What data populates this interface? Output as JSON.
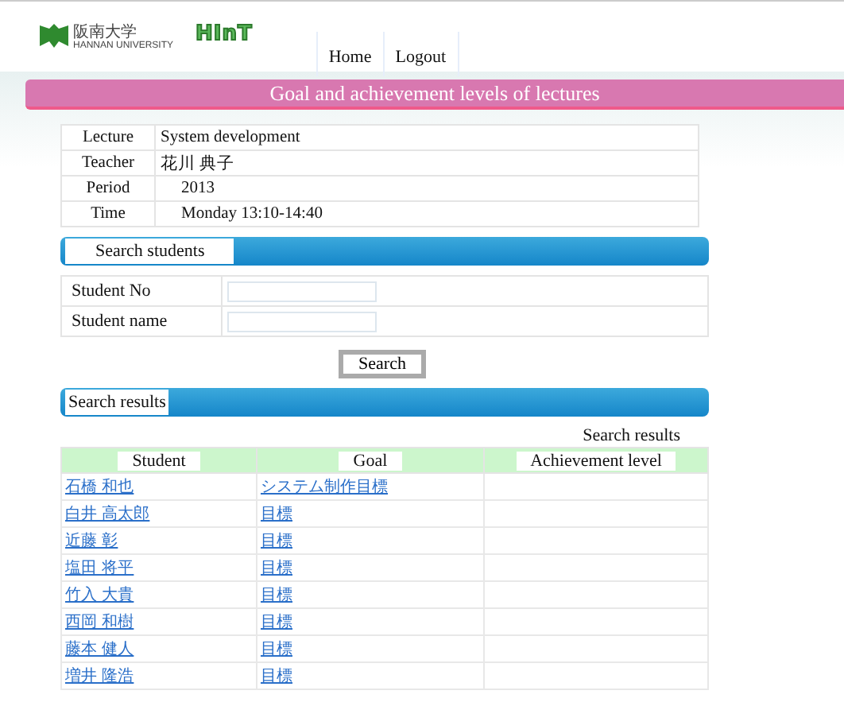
{
  "header": {
    "university_name": "阪南大学",
    "university_subtitle": "HANNAN UNIVERSITY",
    "app_logo": "HInT",
    "nav": [
      "Home",
      "Logout"
    ]
  },
  "page_title": "Goal and achievement levels of lectures",
  "lecture_info": [
    {
      "label": "Lecture",
      "value": "System development"
    },
    {
      "label": "Teacher",
      "value": "花川 典子"
    },
    {
      "label": "Period",
      "value": "2013"
    },
    {
      "label": "Time",
      "value": "Monday 13:10-14:40"
    }
  ],
  "search_section": {
    "title": "Search students",
    "fields": [
      {
        "label": "Student No"
      },
      {
        "label": "Student name"
      }
    ],
    "button": "Search"
  },
  "results_section": {
    "title": "Search results",
    "caption": "Search results",
    "columns": [
      "Student",
      "Goal",
      "Achievement level"
    ],
    "rows": [
      {
        "student": "石橋 和也",
        "goal": "システム制作目標"
      },
      {
        "student": "白井 高太郎",
        "goal": "目標"
      },
      {
        "student": "近藤 彰",
        "goal": "目標"
      },
      {
        "student": "塩田 将平",
        "goal": "目標"
      },
      {
        "student": "竹入 大貴",
        "goal": "目標"
      },
      {
        "student": "西岡 和樹",
        "goal": "目標"
      },
      {
        "student": "藤本 健人",
        "goal": "目標"
      },
      {
        "student": "増井 隆浩",
        "goal": "目標"
      }
    ]
  }
}
